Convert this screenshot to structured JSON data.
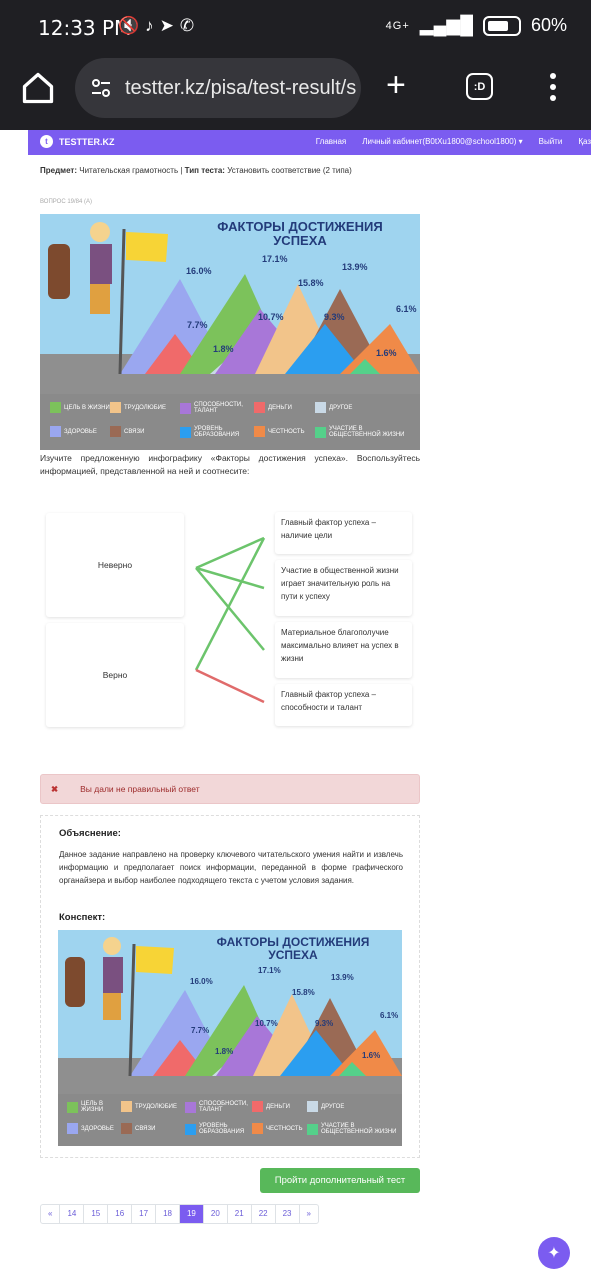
{
  "status": {
    "time": "12:33 PM",
    "network": "4G+",
    "battery": "60%",
    "icons": [
      "mute-icon",
      "tiktok-icon",
      "telegram-icon",
      "whatsapp-icon"
    ]
  },
  "browser": {
    "url": "testter.kz/pisa/test-result/s"
  },
  "site": {
    "logo": "TESTTER.KZ",
    "nav": [
      "Главная",
      "Личный кабинет(B0tXu1800@school1800) ▾",
      "Выйти",
      "Қаз"
    ]
  },
  "meta": {
    "subject_label": "Предмет:",
    "subject": "Читательская грамотность",
    "type_label": "Тип теста:",
    "type": "Установить соответствие (2 типа)"
  },
  "question": {
    "number": "ВОПРОС 19/84 (A)"
  },
  "infographic": {
    "title_line1": "ФАКТОРЫ ДОСТИЖЕНИЯ",
    "title_line2": "УСПЕХА",
    "percents": [
      "16.0%",
      "17.1%",
      "15.8%",
      "13.9%",
      "6.1%",
      "7.7%",
      "10.7%",
      "9.3%",
      "1.8%",
      "1.6%"
    ],
    "legend": [
      {
        "label": "ЦЕЛЬ В ЖИЗНИ",
        "color": "#7cc25b"
      },
      {
        "label": "ТРУДОЛЮБИЕ",
        "color": "#f2c48a"
      },
      {
        "label": "СПОСОБНОСТИ, ТАЛАНТ",
        "color": "#a877d8"
      },
      {
        "label": "ДЕНЬГИ",
        "color": "#f06a6a"
      },
      {
        "label": "ДРУГОЕ",
        "color": "#c9d9e6"
      },
      {
        "label": "ЗДОРОВЬЕ",
        "color": "#9aa7f0"
      },
      {
        "label": "СВЯЗИ",
        "color": "#9a6a55"
      },
      {
        "label": "УРОВЕНЬ ОБРАЗОВАНИЯ",
        "color": "#2b9ef0"
      },
      {
        "label": "ЧЕСТНОСТЬ",
        "color": "#f08a48"
      },
      {
        "label": "УЧАСТИЕ В ОБЩЕСТВЕННОЙ ЖИЗНИ",
        "color": "#55d08a"
      }
    ]
  },
  "instructions": "Изучите предложенную инфографику «Факторы достижения успеха». Воспользуйтесь информацией, представленной на ней и соотнесите:",
  "match": {
    "left": [
      "Неверно",
      "Верно"
    ],
    "right": [
      "Главный фактор успеха – наличие цели",
      "Участие в общественной жизни играет значительную роль на пути к успеху",
      "Материальное благополучие максимально влияет на успех в жизни",
      "Главный фактор успеха – способности и талант"
    ]
  },
  "result": {
    "message": "Вы дали не правильный ответ"
  },
  "explanation": {
    "heading": "Объяснение:",
    "text": "Данное задание направлено на проверку ключевого читательского умения найти и извлечь информацию и предполагает поиск информации, переданной в форме графического органайзера и выбор наиболее подходящего текста с учетом условия задания.",
    "summary_heading": "Конспект:"
  },
  "actions": {
    "more_test": "Пройти дополнительный тест"
  },
  "pagination": {
    "prev": "«",
    "pages": [
      "14",
      "15",
      "16",
      "17",
      "18",
      "19",
      "20",
      "21",
      "22",
      "23"
    ],
    "active": "19",
    "next": "»"
  }
}
